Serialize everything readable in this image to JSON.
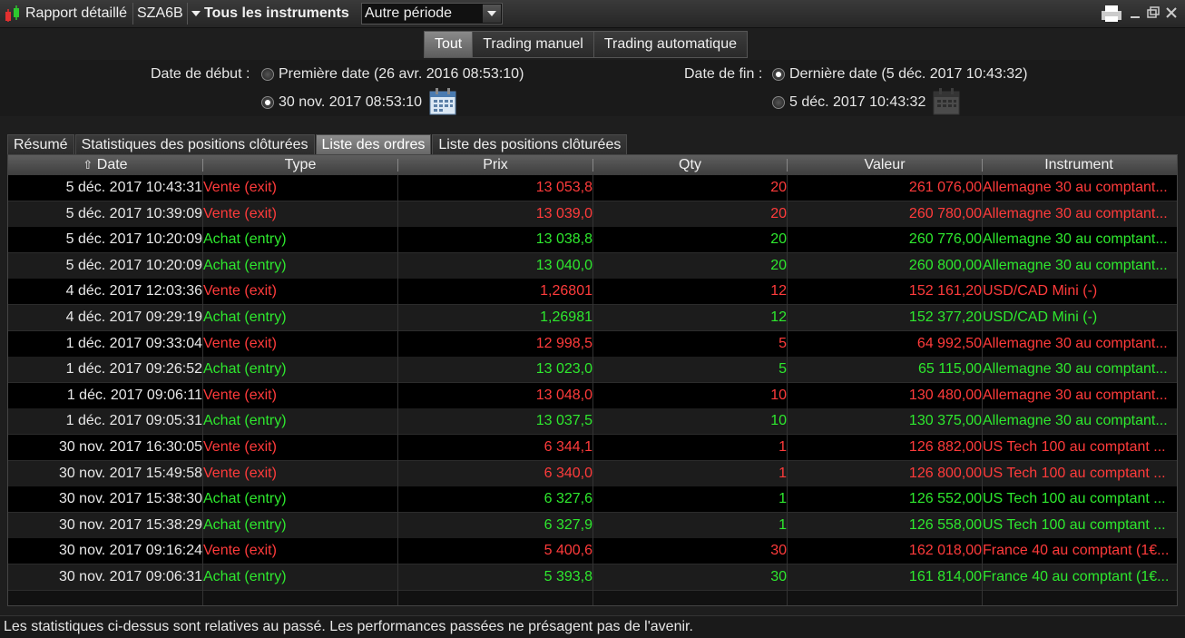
{
  "titlebar": {
    "title": "Rapport détaillé",
    "account": "SZA6B",
    "instruments": "Tous les instruments",
    "period": "Autre période"
  },
  "colors": {
    "sell": "#ff3b3b",
    "buy": "#2ee82e"
  },
  "filter_tabs": [
    {
      "label": "Tout",
      "active": true
    },
    {
      "label": "Trading manuel",
      "active": false
    },
    {
      "label": "Trading automatique",
      "active": false
    }
  ],
  "dates": {
    "start_label": "Date de début :",
    "start_first": "Première date (26 avr. 2016 08:53:10)",
    "start_custom": "30 nov. 2017 08:53:10",
    "end_label": "Date de fin :",
    "end_last": "Dernière date (5 déc. 2017 10:43:32)",
    "end_custom": "5 déc. 2017 10:43:32"
  },
  "report_tabs": [
    {
      "label": "Résumé",
      "active": false
    },
    {
      "label": "Statistiques des positions clôturées",
      "active": false
    },
    {
      "label": "Liste des ordres",
      "active": true
    },
    {
      "label": "Liste des positions clôturées",
      "active": false
    }
  ],
  "table": {
    "sort_icon": "arrow-up-icon",
    "headers": [
      "Date",
      "Type",
      "Prix",
      "Qty",
      "Valeur",
      "Instrument"
    ],
    "rows": [
      {
        "date": "5 déc. 2017 10:43:31",
        "type": "Vente (exit)",
        "prix": "13 053,8",
        "qty": "20",
        "valeur": "261 076,00",
        "instrument": "Allemagne 30 au comptant...",
        "side": "sell"
      },
      {
        "date": "5 déc. 2017 10:39:09",
        "type": "Vente (exit)",
        "prix": "13 039,0",
        "qty": "20",
        "valeur": "260 780,00",
        "instrument": "Allemagne 30 au comptant...",
        "side": "sell"
      },
      {
        "date": "5 déc. 2017 10:20:09",
        "type": "Achat (entry)",
        "prix": "13 038,8",
        "qty": "20",
        "valeur": "260 776,00",
        "instrument": "Allemagne 30 au comptant...",
        "side": "buy"
      },
      {
        "date": "5 déc. 2017 10:20:09",
        "type": "Achat (entry)",
        "prix": "13 040,0",
        "qty": "20",
        "valeur": "260 800,00",
        "instrument": "Allemagne 30 au comptant...",
        "side": "buy"
      },
      {
        "date": "4 déc. 2017 12:03:36",
        "type": "Vente (exit)",
        "prix": "1,26801",
        "qty": "12",
        "valeur": "152 161,20",
        "instrument": "USD/CAD Mini (-)",
        "side": "sell"
      },
      {
        "date": "4 déc. 2017 09:29:19",
        "type": "Achat (entry)",
        "prix": "1,26981",
        "qty": "12",
        "valeur": "152 377,20",
        "instrument": "USD/CAD Mini (-)",
        "side": "buy"
      },
      {
        "date": "1 déc. 2017 09:33:04",
        "type": "Vente (exit)",
        "prix": "12 998,5",
        "qty": "5",
        "valeur": "64 992,50",
        "instrument": "Allemagne 30 au comptant...",
        "side": "sell"
      },
      {
        "date": "1 déc. 2017 09:26:52",
        "type": "Achat (entry)",
        "prix": "13 023,0",
        "qty": "5",
        "valeur": "65 115,00",
        "instrument": "Allemagne 30 au comptant...",
        "side": "buy"
      },
      {
        "date": "1 déc. 2017 09:06:11",
        "type": "Vente (exit)",
        "prix": "13 048,0",
        "qty": "10",
        "valeur": "130 480,00",
        "instrument": "Allemagne 30 au comptant...",
        "side": "sell"
      },
      {
        "date": "1 déc. 2017 09:05:31",
        "type": "Achat (entry)",
        "prix": "13 037,5",
        "qty": "10",
        "valeur": "130 375,00",
        "instrument": "Allemagne 30 au comptant...",
        "side": "buy"
      },
      {
        "date": "30 nov. 2017 16:30:05",
        "type": "Vente (exit)",
        "prix": "6 344,1",
        "qty": "1",
        "valeur": "126 882,00",
        "instrument": "US Tech 100 au comptant ...",
        "side": "sell"
      },
      {
        "date": "30 nov. 2017 15:49:58",
        "type": "Vente (exit)",
        "prix": "6 340,0",
        "qty": "1",
        "valeur": "126 800,00",
        "instrument": "US Tech 100 au comptant ...",
        "side": "sell"
      },
      {
        "date": "30 nov. 2017 15:38:30",
        "type": "Achat (entry)",
        "prix": "6 327,6",
        "qty": "1",
        "valeur": "126 552,00",
        "instrument": "US Tech 100 au comptant ...",
        "side": "buy"
      },
      {
        "date": "30 nov. 2017 15:38:29",
        "type": "Achat (entry)",
        "prix": "6 327,9",
        "qty": "1",
        "valeur": "126 558,00",
        "instrument": "US Tech 100 au comptant ...",
        "side": "buy"
      },
      {
        "date": "30 nov. 2017 09:16:24",
        "type": "Vente (exit)",
        "prix": "5 400,6",
        "qty": "30",
        "valeur": "162 018,00",
        "instrument": "France 40 au comptant (1€...",
        "side": "sell"
      },
      {
        "date": "30 nov. 2017 09:06:31",
        "type": "Achat (entry)",
        "prix": "5 393,8",
        "qty": "30",
        "valeur": "161 814,00",
        "instrument": "France 40 au comptant (1€...",
        "side": "buy"
      }
    ]
  },
  "footer": "Les statistiques ci-dessus sont relatives au passé. Les performances passées ne présagent pas de l'avenir."
}
